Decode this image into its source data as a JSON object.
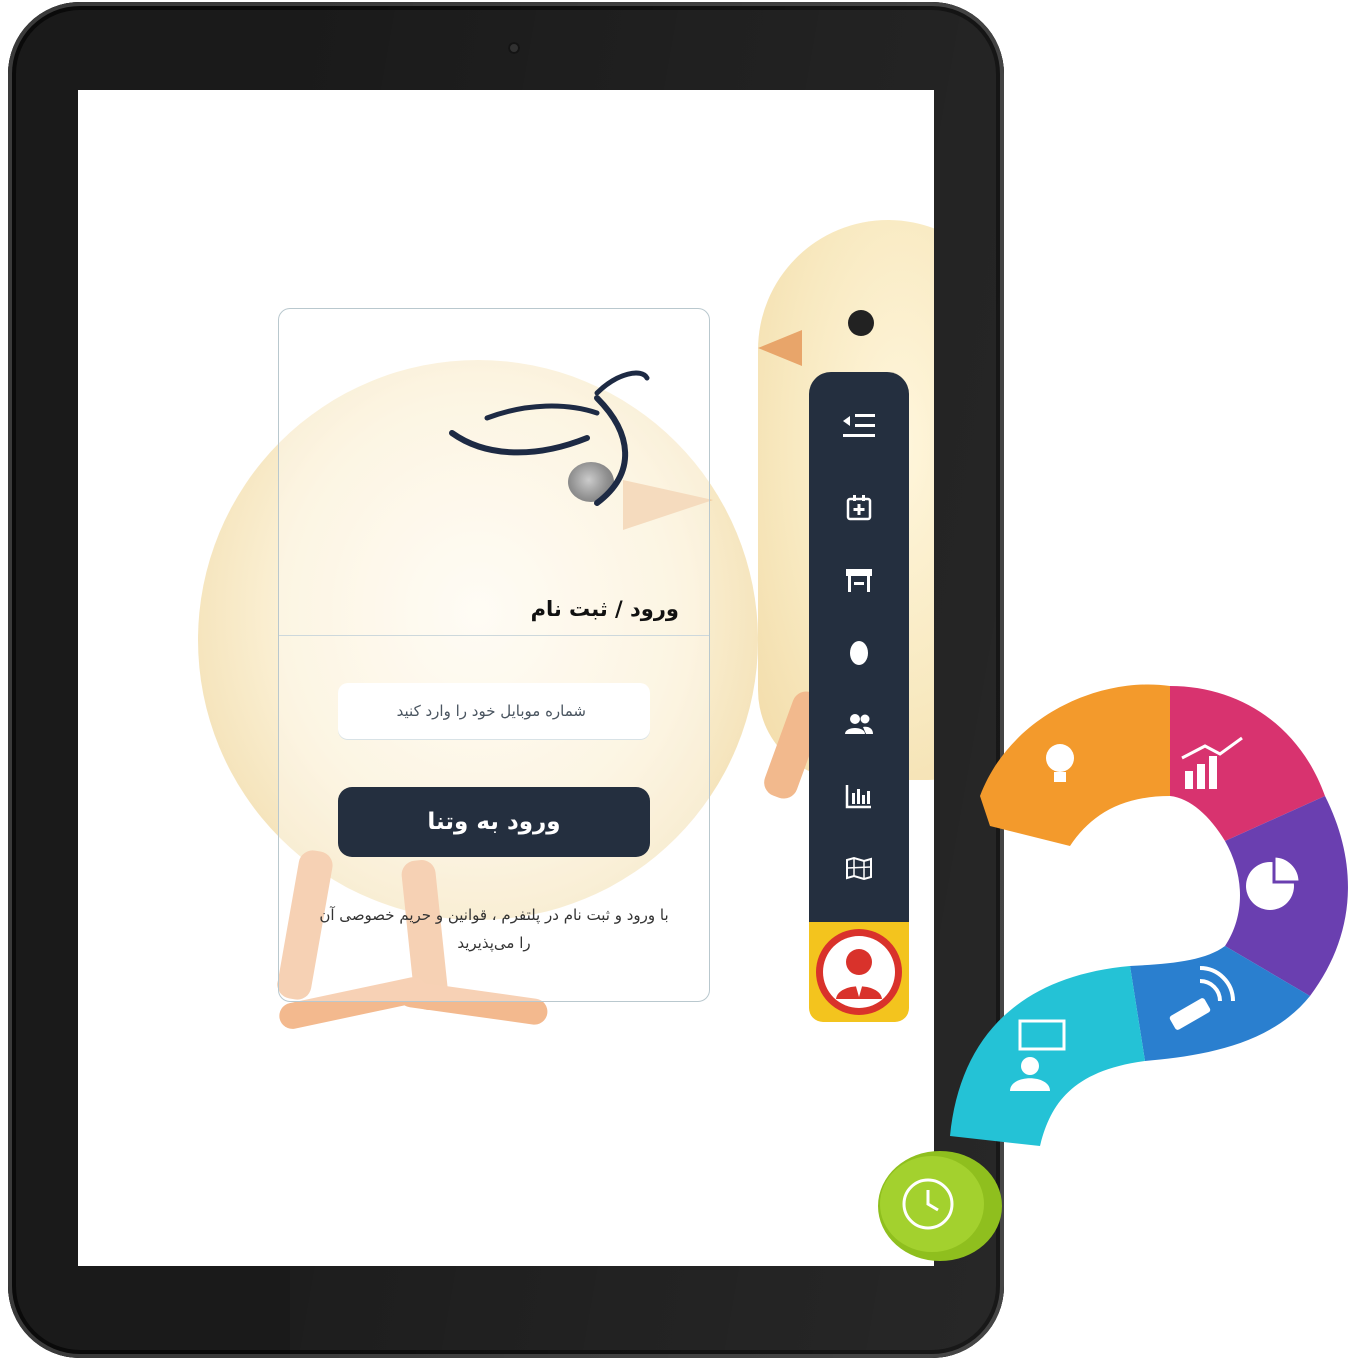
{
  "login": {
    "title": "ورود / ثبت نام",
    "phone_placeholder": "شماره موبایل خود را وارد کنید",
    "submit_label": "ورود به وتنا",
    "terms_text": "با ورود و ثبت نام در پلتفرم ، قوانین و حریم خصوصی آن را می‌پذیرید"
  },
  "sidebar": {
    "items": [
      {
        "icon": "collapse-menu-icon"
      },
      {
        "icon": "calendar-add-icon"
      },
      {
        "icon": "store-icon"
      },
      {
        "icon": "egg-icon"
      },
      {
        "icon": "users-icon"
      },
      {
        "icon": "bar-chart-icon"
      },
      {
        "icon": "map-icon"
      }
    ],
    "avatar_icon": "user-avatar-icon"
  },
  "question_graphic": {
    "segments": [
      {
        "icon": "lightbulb-icon",
        "color": "#f39a2c"
      },
      {
        "icon": "growth-chart-icon",
        "color": "#d8336f"
      },
      {
        "icon": "pie-chart-icon",
        "color": "#6a3fb0"
      },
      {
        "icon": "router-icon",
        "color": "#2a7fcf"
      },
      {
        "icon": "presenter-icon",
        "color": "#24c2d6"
      },
      {
        "icon": "clock-icon",
        "color": "#9ccb2c"
      }
    ]
  },
  "colors": {
    "dark_navy": "#242f3f",
    "avatar_bg": "#f3c41e",
    "avatar_red": "#d9322b"
  }
}
